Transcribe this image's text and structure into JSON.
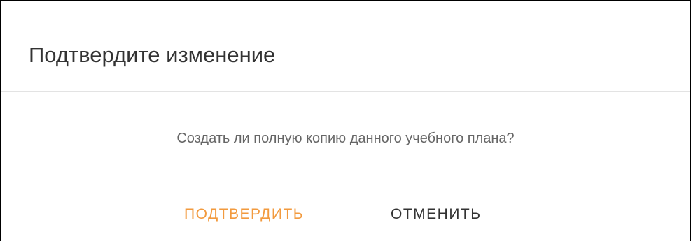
{
  "dialog": {
    "title": "Подтвердите изменение",
    "message": "Создать ли полную копию данного учебного плана?",
    "actions": {
      "confirm_label": "ПОДТВЕРДИТЬ",
      "cancel_label": "ОТМЕНИТЬ"
    }
  },
  "colors": {
    "accent": "#f29a3e",
    "title_text": "#333333",
    "message_text": "#666666",
    "divider": "#e3e3e3"
  }
}
